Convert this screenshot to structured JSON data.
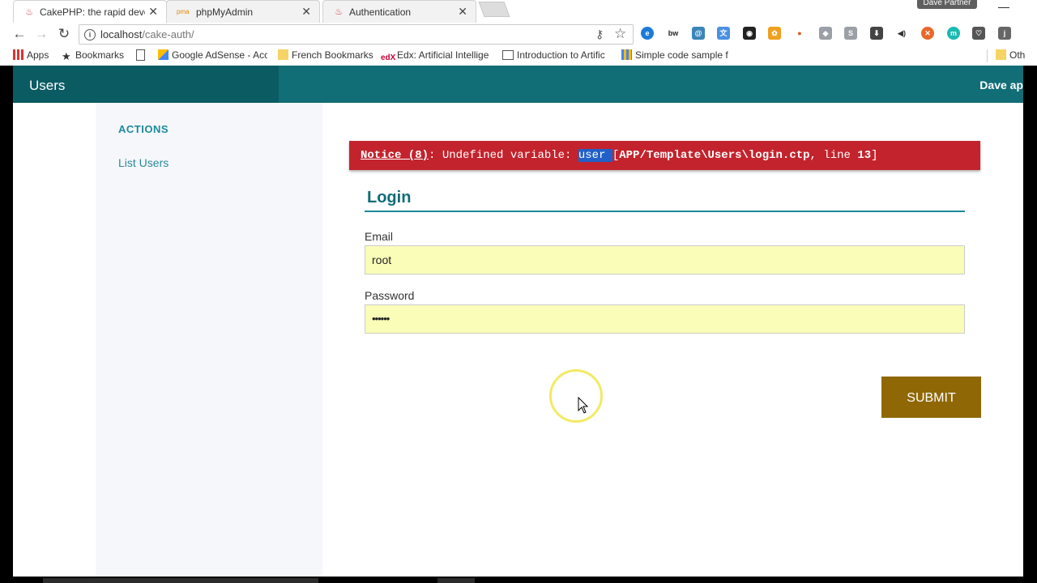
{
  "browser": {
    "tabs": [
      {
        "title": "CakePHP: the rapid deve",
        "active": true,
        "close": "✕"
      },
      {
        "title": "phpMyAdmin",
        "active": false,
        "close": "✕"
      },
      {
        "title": "Authentication",
        "active": false,
        "close": "✕"
      }
    ],
    "profile": "Dave Partner",
    "url_host": "localhost",
    "url_path": "/cake-auth/",
    "bookmarks": [
      {
        "label": "Apps",
        "icon": "apps-grid-icon"
      },
      {
        "label": "Bookmarks",
        "icon": "star-icon"
      },
      {
        "label": "",
        "icon": "page-icon"
      },
      {
        "label": "Google AdSense - Acc",
        "icon": "adsense-icon"
      },
      {
        "label": "French Bookmarks",
        "icon": "folder-icon"
      },
      {
        "label": "Edx: Artificial Intellige",
        "icon": "edx-icon"
      },
      {
        "label": "Introduction to Artific",
        "icon": "page-icon"
      },
      {
        "label": "Simple code sample f",
        "icon": "grid-icon"
      },
      {
        "label": "Oth",
        "icon": "folder-icon"
      }
    ]
  },
  "app": {
    "brand": "Users",
    "topbar_right": "Dave ap",
    "sidebar": {
      "heading": "ACTIONS",
      "links": [
        "List Users"
      ]
    },
    "notice": {
      "label": "Notice (8)",
      "message": ": Undefined variable: ",
      "variable": "user ",
      "location_pre": "[",
      "location_bold": "APP/Template\\Users\\login.ctp",
      "location_mid": ", line ",
      "line": "13",
      "location_post": "]"
    },
    "form": {
      "legend": "Login",
      "email_label": "Email",
      "email_value": "root",
      "password_label": "Password",
      "password_value": "••••••",
      "submit_label": "SUBMIT"
    }
  },
  "colors": {
    "topbar": "#116d76",
    "notice": "#c3232d",
    "submit": "#8f6705",
    "input_bg": "#fafdb8"
  }
}
